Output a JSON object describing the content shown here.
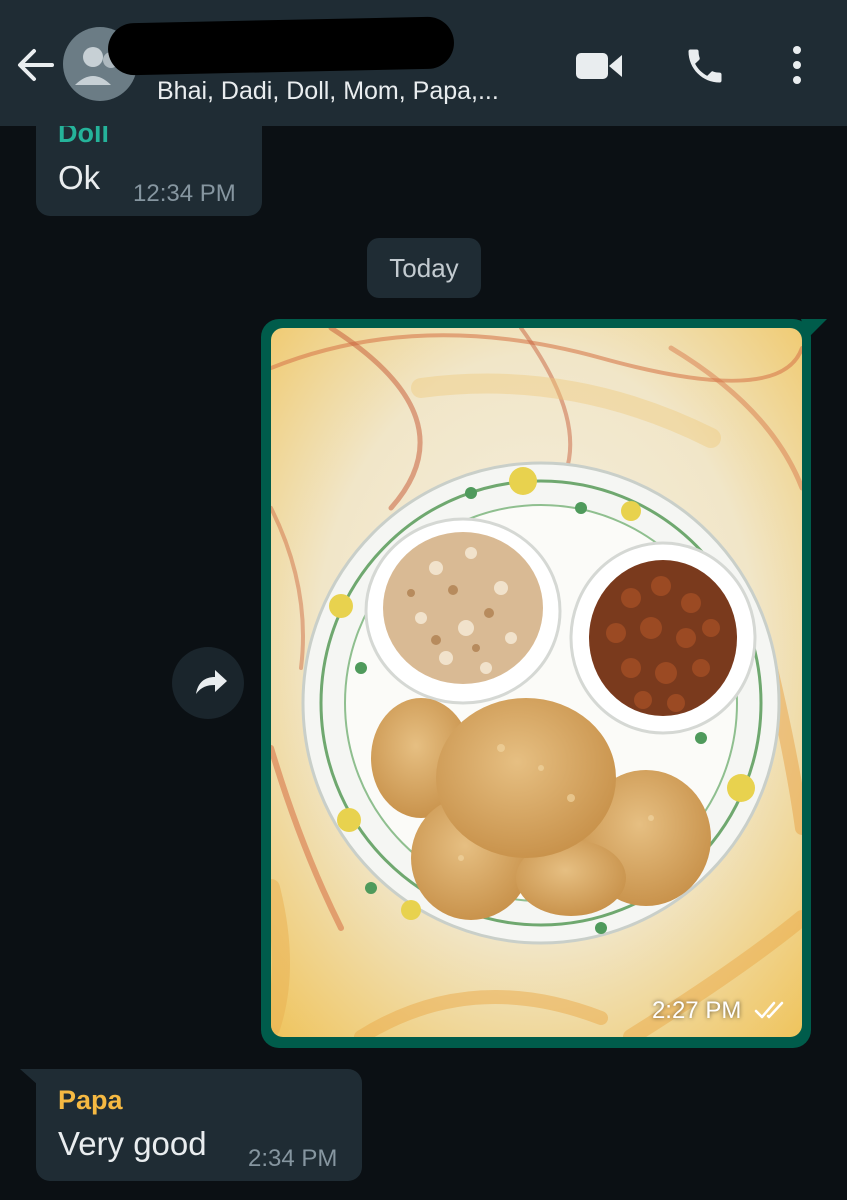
{
  "header": {
    "members": "Bhai, Dadi, Doll, Mom, Papa,..."
  },
  "messages": [
    {
      "sender": "Doll",
      "text": "Ok",
      "time": "12:34 PM"
    },
    {
      "date_label": "Today"
    },
    {
      "type": "photo",
      "time": "2:27 PM",
      "status": "read-double-tick-icon"
    },
    {
      "sender": "Papa",
      "text": "Very good",
      "time": "2:34 PM"
    }
  ],
  "colors": {
    "header_bg": "#1f2c34",
    "chat_bg": "#0b1014",
    "incoming_bubble": "#1f2c34",
    "outgoing_bubble": "#005c4b",
    "sender_doll": "#25b39a",
    "sender_papa": "#f5b942"
  }
}
